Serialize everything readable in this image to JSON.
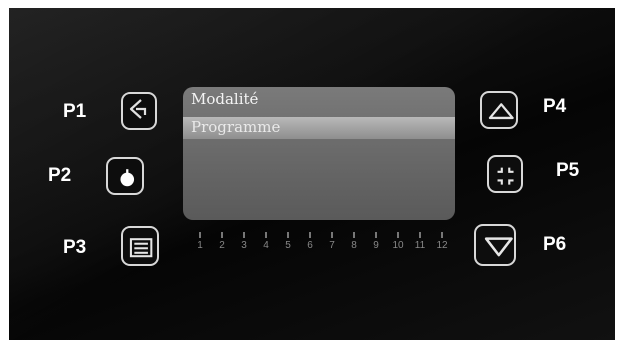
{
  "labels": {
    "p1": "P1",
    "p2": "P2",
    "p3": "P3",
    "p4": "P4",
    "p5": "P5",
    "p6": "P6"
  },
  "icons": {
    "p1": "back-arrow-icon",
    "p2": "power-icon",
    "p3": "menu-list-icon",
    "p4": "up-triangle-icon",
    "p5": "fullscreen-corners-icon",
    "p6": "down-triangle-icon"
  },
  "screen": {
    "title": "Modalité",
    "selected_item": "Programme"
  },
  "scale": [
    "1",
    "2",
    "3",
    "4",
    "5",
    "6",
    "7",
    "8",
    "9",
    "10",
    "11",
    "12"
  ]
}
